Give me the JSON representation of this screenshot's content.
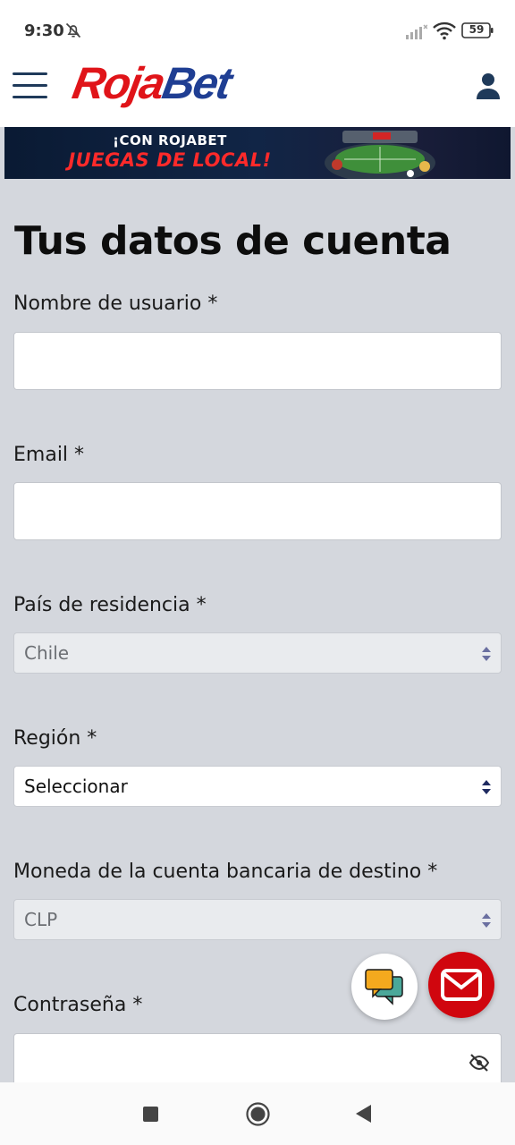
{
  "status": {
    "time": "9:30",
    "battery": "59",
    "icons": [
      "notifications-off-icon",
      "signal-icon",
      "wifi-icon",
      "battery-icon"
    ]
  },
  "header": {
    "logo_part1": "Roja",
    "logo_part2": "Bet",
    "icons": [
      "menu-icon",
      "user-icon"
    ]
  },
  "banner": {
    "line1": "¡CON ROJABET",
    "line2": "JUEGAS DE LOCAL!"
  },
  "form": {
    "title": "Tus datos de cuenta",
    "username": {
      "label": "Nombre de usuario *",
      "value": ""
    },
    "email": {
      "label": "Email *",
      "value": ""
    },
    "country": {
      "label": "País de residencia *",
      "value": "Chile"
    },
    "region": {
      "label": "Región *",
      "value": "Seleccionar"
    },
    "currency": {
      "label": "Moneda de la cuenta bancaria de destino *",
      "value": "CLP"
    },
    "password": {
      "label": "Contraseña *",
      "value": ""
    }
  },
  "colors": {
    "brand_red": "#e01419",
    "brand_blue": "#1f3e93",
    "page_bg": "#d4d7dd",
    "mail_fab": "#d0060e"
  },
  "fabs": [
    "chat-icon",
    "mail-icon"
  ],
  "navbar": [
    "recent-apps-icon",
    "home-icon",
    "back-icon"
  ]
}
